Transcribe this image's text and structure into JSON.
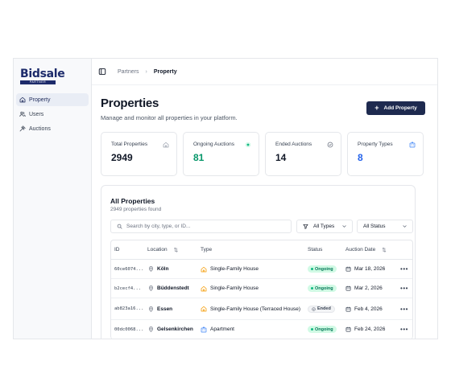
{
  "brand": {
    "name": "Bidsale",
    "tagline": "PARTNER"
  },
  "sidebar": {
    "items": [
      {
        "label": "Property",
        "icon": "home-icon",
        "active": true
      },
      {
        "label": "Users",
        "icon": "users-icon",
        "active": false
      },
      {
        "label": "Auctions",
        "icon": "gavel-icon",
        "active": false
      }
    ]
  },
  "breadcrumb": {
    "parent": "Partners",
    "current": "Property"
  },
  "header": {
    "title": "Properties",
    "subtitle": "Manage and monitor all properties in your platform.",
    "add_button": "Add Property"
  },
  "stats": [
    {
      "label": "Total Properties",
      "value": "2949",
      "icon": "home-icon",
      "color": "#111827"
    },
    {
      "label": "Ongoing Auctions",
      "value": "81",
      "icon": "live-dot-icon",
      "color": "#059669"
    },
    {
      "label": "Ended Auctions",
      "value": "14",
      "icon": "clock-check-icon",
      "color": "#111827"
    },
    {
      "label": "Property Types",
      "value": "8",
      "icon": "building-icon",
      "color": "#2563eb"
    }
  ],
  "panel": {
    "title": "All Properties",
    "subtitle": "2949 properties found",
    "search_placeholder": "Search by city, type, or ID...",
    "type_filter": "All Types",
    "status_filter": "All Status"
  },
  "table": {
    "columns": {
      "id": "ID",
      "location": "Location",
      "type": "Type",
      "status": "Status",
      "auction_date": "Auction Date"
    },
    "rows": [
      {
        "id": "60ce6074...",
        "location": "Köln",
        "type": "Single-Family House",
        "type_icon": "house-icon",
        "status": "Ongoing",
        "date": "Mar 18, 2026"
      },
      {
        "id": "b2cecf4...",
        "location": "Büddenstedt",
        "type": "Single-Family House",
        "type_icon": "house-icon",
        "status": "Ongoing",
        "date": "Mar 2, 2026"
      },
      {
        "id": "ab823a16...",
        "location": "Essen",
        "type": "Single-Family House (Terraced House)",
        "type_icon": "house-icon",
        "status": "Ended",
        "date": "Feb 4, 2026"
      },
      {
        "id": "00dc0068...",
        "location": "Gelsenkirchen",
        "type": "Apartment",
        "type_icon": "building-icon",
        "status": "Ongoing",
        "date": "Feb 24, 2026"
      }
    ]
  },
  "colors": {
    "accent": "#1e2a4f",
    "ongoing": "#059669",
    "info": "#2563eb",
    "house_icon": "#f59e0b"
  }
}
